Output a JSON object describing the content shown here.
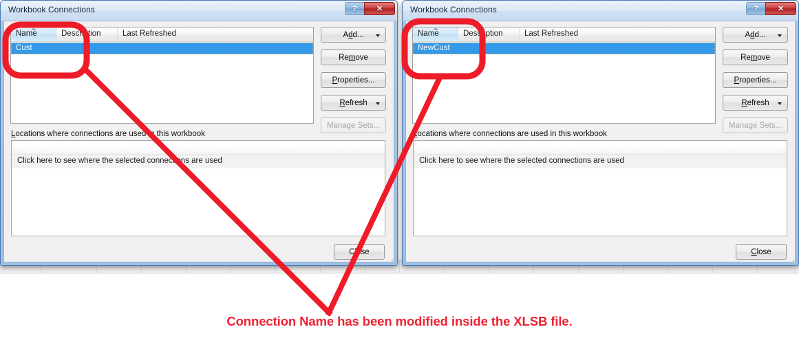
{
  "accent": {
    "annotation_red": "#ee1c28",
    "selection_blue": "#3399e8",
    "title_text": "#10273f"
  },
  "dialogs": [
    {
      "id": "left",
      "title": "Workbook Connections",
      "titlebar_buttons": [
        {
          "name": "help-button",
          "glyph": "?"
        },
        {
          "name": "close-button",
          "glyph": "✕"
        }
      ],
      "list": {
        "columns": [
          "Name",
          "Description",
          "Last Refreshed"
        ],
        "sorted_column": "Name",
        "sort_direction": "ascending",
        "rows": [
          {
            "name": "Cust",
            "description": "",
            "last_refreshed": "",
            "selected": true
          }
        ]
      },
      "buttons": [
        {
          "label": "Add...",
          "accesskey": "d",
          "split": true,
          "disabled": false
        },
        {
          "label": "Remove",
          "accesskey": "m",
          "split": false,
          "disabled": false
        },
        {
          "label": "Properties...",
          "accesskey": "P",
          "split": false,
          "disabled": false
        },
        {
          "label": "Refresh",
          "accesskey": "R",
          "split": true,
          "disabled": false
        },
        {
          "label": "Manage Sets...",
          "accesskey": "",
          "split": false,
          "disabled": true
        }
      ],
      "locations": {
        "label": "Locations where connections are used in this workbook",
        "label_accesskey": "L",
        "hint": "Click here to see where the selected connections are used"
      },
      "close_button": {
        "label": "Close",
        "accesskey": ""
      }
    },
    {
      "id": "right",
      "title": "Workbook Connections",
      "titlebar_buttons": [
        {
          "name": "help-button",
          "glyph": "?"
        },
        {
          "name": "close-button",
          "glyph": "✕"
        }
      ],
      "list": {
        "columns": [
          "Name",
          "Description",
          "Last Refreshed"
        ],
        "sorted_column": "Name",
        "sort_direction": "ascending",
        "rows": [
          {
            "name": "NewCust",
            "description": "",
            "last_refreshed": "",
            "selected": true
          }
        ]
      },
      "buttons": [
        {
          "label": "Add...",
          "accesskey": "d",
          "split": true,
          "disabled": false
        },
        {
          "label": "Remove",
          "accesskey": "m",
          "split": false,
          "disabled": false
        },
        {
          "label": "Properties...",
          "accesskey": "P",
          "split": false,
          "disabled": false
        },
        {
          "label": "Refresh",
          "accesskey": "R",
          "split": true,
          "disabled": false
        },
        {
          "label": "Manage Sets...",
          "accesskey": "",
          "split": false,
          "disabled": true
        }
      ],
      "locations": {
        "label": "Locations where connections are used in this workbook",
        "label_accesskey": "L",
        "hint": "Click here to see where the selected connections are used"
      },
      "close_button": {
        "label": "Close",
        "accesskey": "C"
      }
    }
  ],
  "annotation": {
    "caption": "Connection Name has been modified inside the XLSB file.",
    "highlight_shape": "rounded-rectangle",
    "pointer_shape": "v-arrow",
    "targets": [
      "Cust",
      "NewCust"
    ]
  }
}
